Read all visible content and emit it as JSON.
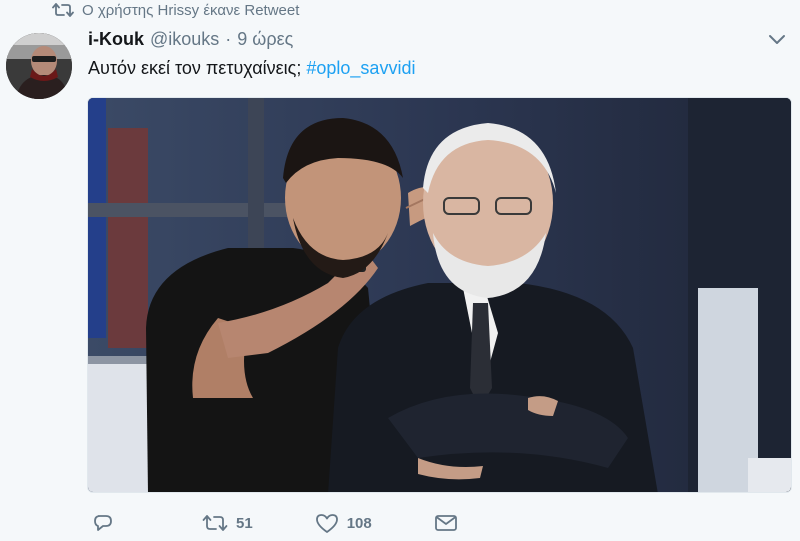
{
  "retweet_context": {
    "text": "Ο χρήστης Hrissy έκανε Retweet",
    "icon": "retweet-icon"
  },
  "tweet": {
    "author": {
      "name": "i-Kouk",
      "handle": "@ikouks",
      "avatar_icon": "avatar"
    },
    "separator": "·",
    "time": "9 ώρες",
    "text": "Αυτόν εκεί τον πετυχαίνεις;",
    "hashtag": "#oplo_savvidi",
    "media": {
      "type": "photo"
    },
    "actions": {
      "reply": {
        "icon": "reply-icon",
        "count": ""
      },
      "retweet": {
        "icon": "retweet-icon",
        "count": "51"
      },
      "like": {
        "icon": "heart-icon",
        "count": "108"
      },
      "dm": {
        "icon": "envelope-icon"
      }
    }
  },
  "colors": {
    "background": "#f5f8fa",
    "text": "#14171a",
    "muted": "#657786",
    "link": "#1da1f2"
  }
}
